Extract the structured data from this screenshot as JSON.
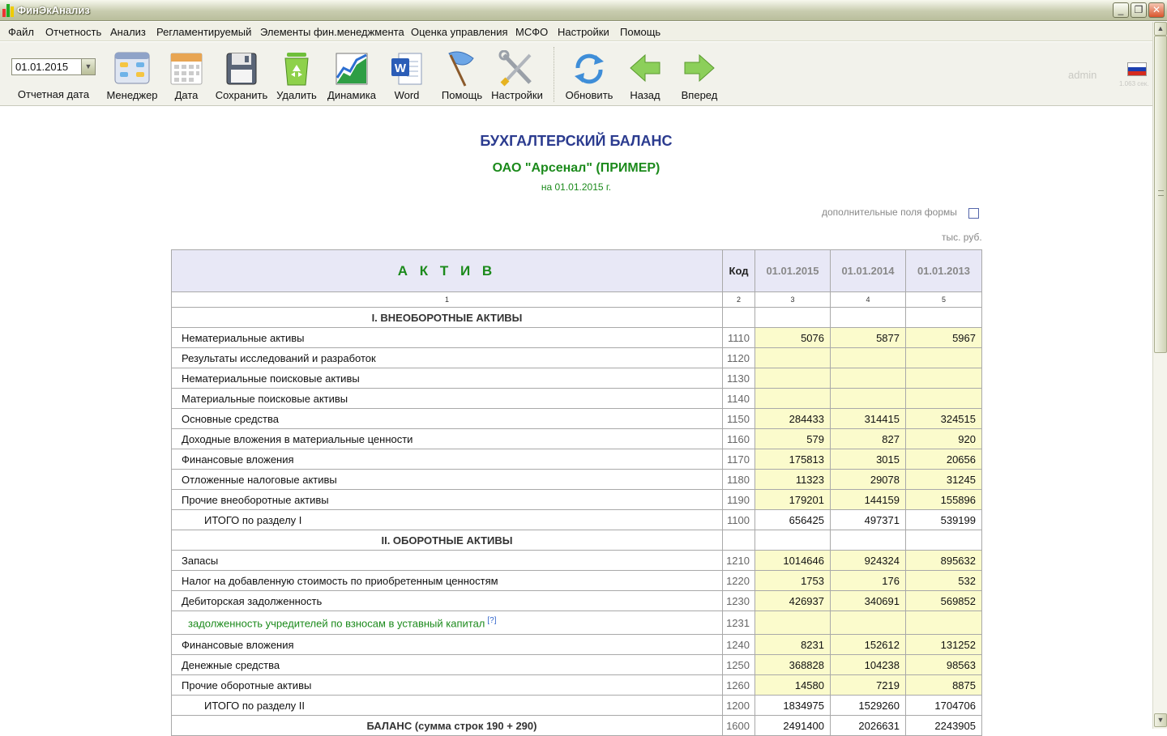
{
  "window": {
    "title": "ФинЭкАнализ",
    "minimize": "_",
    "restore": "❐",
    "close": "✕"
  },
  "menu": [
    "Файл",
    "Отчетность",
    "Анализ",
    "Регламентируемый",
    "Элементы фин.менеджмента",
    "Оценка управления",
    "МСФО",
    "Настройки",
    "Помощь"
  ],
  "toolbar": {
    "date_value": "01.01.2015",
    "date_caption": "Отчетная дата",
    "buttons": [
      {
        "label": "Менеджер",
        "icon": "manager-icon"
      },
      {
        "label": "Дата",
        "icon": "calendar-icon"
      },
      {
        "label": "Сохранить",
        "icon": "save-floppy-icon"
      },
      {
        "label": "Удалить",
        "icon": "recycle-bin-icon"
      },
      {
        "label": "Динамика",
        "icon": "dynamics-chart-icon"
      },
      {
        "label": "Word",
        "icon": "word-icon"
      },
      {
        "label": "Помощь",
        "icon": "help-flag-icon"
      },
      {
        "label": "Настройки",
        "icon": "settings-tools-icon"
      },
      {
        "label": "Обновить",
        "icon": "refresh-icon"
      },
      {
        "label": "Назад",
        "icon": "back-arrow-icon"
      },
      {
        "label": "Вперед",
        "icon": "forward-arrow-icon"
      }
    ],
    "user": "admin",
    "timing": "1.063 сек.",
    "language_flag": "russia-flag-icon"
  },
  "colors": {
    "title": "#2b3b8f",
    "green": "#1b8a1b",
    "cell_input": "#fbfbcc",
    "header_bg": "#e8e8f6"
  },
  "document": {
    "title": "БУХГАЛТЕРСКИЙ БАЛАНС",
    "organization": "ОАО \"Арсенал\" (ПРИМЕР)",
    "date": "на 01.01.2015 г.",
    "extra_fields_label": "дополнительные поля формы",
    "units": "тыс. руб."
  },
  "table": {
    "headers": {
      "aktiv": "А К Т И В",
      "code": "Код",
      "d1": "01.01.2015",
      "d2": "01.01.2014",
      "d3": "01.01.2013"
    },
    "col_numbers": [
      "1",
      "2",
      "3",
      "4",
      "5"
    ],
    "rows": [
      {
        "type": "sec",
        "name": "I. ВНЕОБОРОТНЫЕ АКТИВЫ",
        "code": "",
        "v": [
          "",
          "",
          ""
        ]
      },
      {
        "type": "r",
        "name": "Нематериальные активы",
        "code": "1110",
        "v": [
          "5076",
          "5877",
          "5967"
        ]
      },
      {
        "type": "r",
        "name": "Результаты исследований и разработок",
        "code": "1120",
        "v": [
          "",
          "",
          ""
        ]
      },
      {
        "type": "r",
        "name": "Нематериальные поисковые активы",
        "code": "1130",
        "v": [
          "",
          "",
          ""
        ]
      },
      {
        "type": "r",
        "name": "Материальные поисковые активы",
        "code": "1140",
        "v": [
          "",
          "",
          ""
        ]
      },
      {
        "type": "r",
        "name": "Основные средства",
        "code": "1150",
        "v": [
          "284433",
          "314415",
          "324515"
        ]
      },
      {
        "type": "r",
        "name": "Доходные вложения в материальные ценности",
        "code": "1160",
        "v": [
          "579",
          "827",
          "920"
        ]
      },
      {
        "type": "r",
        "name": "Финансовые вложения",
        "code": "1170",
        "v": [
          "175813",
          "3015",
          "20656"
        ]
      },
      {
        "type": "r",
        "name": "Отложенные налоговые активы",
        "code": "1180",
        "v": [
          "11323",
          "29078",
          "31245"
        ]
      },
      {
        "type": "r",
        "name": "Прочие внеоборотные активы",
        "code": "1190",
        "v": [
          "179201",
          "144159",
          "155896"
        ]
      },
      {
        "type": "total",
        "name": "ИТОГО по разделу I",
        "code": "1100",
        "v": [
          "656425",
          "497371",
          "539199"
        ]
      },
      {
        "type": "sec",
        "name": "II. ОБОРОТНЫЕ АКТИВЫ",
        "code": "",
        "v": [
          "",
          "",
          ""
        ]
      },
      {
        "type": "r",
        "name": "Запасы",
        "code": "1210",
        "v": [
          "1014646",
          "924324",
          "895632"
        ]
      },
      {
        "type": "r",
        "name": "Налог на добавленную стоимость по приобретенным ценностям",
        "code": "1220",
        "v": [
          "1753",
          "176",
          "532"
        ]
      },
      {
        "type": "r",
        "name": "Дебиторская задолженность",
        "code": "1230",
        "v": [
          "426937",
          "340691",
          "569852"
        ]
      },
      {
        "type": "sub",
        "name": "задолженность учредителей по взносам в уставный капитал",
        "help": "[?]",
        "code": "1231",
        "v": [
          "",
          "",
          ""
        ]
      },
      {
        "type": "r",
        "name": "Финансовые вложения",
        "code": "1240",
        "v": [
          "8231",
          "152612",
          "131252"
        ]
      },
      {
        "type": "r",
        "name": "Денежные средства",
        "code": "1250",
        "v": [
          "368828",
          "104238",
          "98563"
        ]
      },
      {
        "type": "r",
        "name": "Прочие оборотные активы",
        "code": "1260",
        "v": [
          "14580",
          "7219",
          "8875"
        ]
      },
      {
        "type": "total",
        "name": "ИТОГО по разделу II",
        "code": "1200",
        "v": [
          "1834975",
          "1529260",
          "1704706"
        ]
      },
      {
        "type": "bal",
        "name": "БАЛАНС (сумма строк 190 + 290)",
        "code": "1600",
        "v": [
          "2491400",
          "2026631",
          "2243905"
        ]
      }
    ]
  }
}
